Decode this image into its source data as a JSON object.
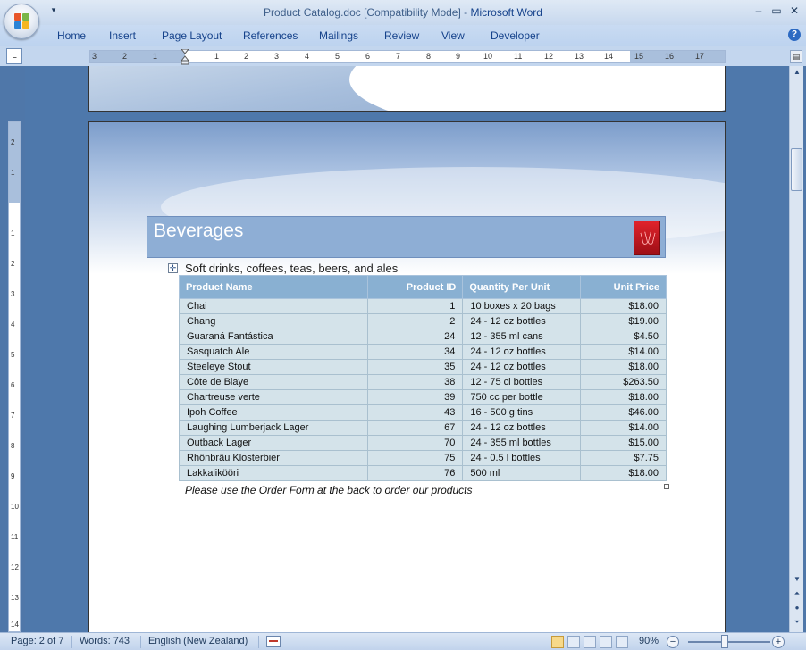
{
  "window": {
    "title_doc": "Product Catalog.doc [Compatibility Mode]",
    "title_sep": " - ",
    "title_app": "Microsoft Word"
  },
  "ribbon_tabs": [
    "Home",
    "Insert",
    "Page Layout",
    "References",
    "Mailings",
    "Review",
    "View",
    "Developer"
  ],
  "ruler": {
    "h_labels": [
      "3",
      "2",
      "1",
      "1",
      "2",
      "3",
      "4",
      "5",
      "6",
      "7",
      "8",
      "9",
      "10",
      "11",
      "12",
      "13",
      "14",
      "15",
      "16",
      "17"
    ],
    "v_labels": [
      "2",
      "1",
      "1",
      "2",
      "3",
      "4",
      "5",
      "6",
      "7",
      "8",
      "9",
      "10",
      "11",
      "12",
      "13",
      "14"
    ]
  },
  "document": {
    "section_title": "Beverages",
    "subtitle": "Soft drinks, coffees, teas, beers, and ales",
    "table": {
      "headers": [
        "Product Name",
        "Product ID",
        "Quantity Per Unit",
        "Unit Price"
      ],
      "rows": [
        [
          "Chai",
          "1",
          "10 boxes x 20 bags",
          "$18.00"
        ],
        [
          "Chang",
          "2",
          "24 - 12 oz bottles",
          "$19.00"
        ],
        [
          "Guaraná Fantástica",
          "24",
          "12 - 355 ml cans",
          "$4.50"
        ],
        [
          "Sasquatch Ale",
          "34",
          "24 - 12 oz bottles",
          "$14.00"
        ],
        [
          "Steeleye Stout",
          "35",
          "24 - 12 oz bottles",
          "$18.00"
        ],
        [
          "Côte de Blaye",
          "38",
          "12 - 75 cl bottles",
          "$263.50"
        ],
        [
          "Chartreuse verte",
          "39",
          "750 cc per bottle",
          "$18.00"
        ],
        [
          "Ipoh Coffee",
          "43",
          "16 - 500 g tins",
          "$46.00"
        ],
        [
          "Laughing Lumberjack Lager",
          "67",
          "24 - 12 oz bottles",
          "$14.00"
        ],
        [
          "Outback Lager",
          "70",
          "24 - 355 ml bottles",
          "$15.00"
        ],
        [
          "Rhönbräu Klosterbier",
          "75",
          "24 - 0.5 l bottles",
          "$7.75"
        ],
        [
          "Lakkalikööri",
          "76",
          "500 ml",
          "$18.00"
        ]
      ]
    },
    "footnote": "Please use the Order Form at the back to order our products"
  },
  "status": {
    "page": "Page: 2 of 7",
    "words": "Words: 743",
    "language": "English (New Zealand)",
    "zoom": "90%",
    "zoom_level_percent": 90
  },
  "icons": {
    "office": "office-logo-icon",
    "qat_dropdown": "qat-dropdown-icon",
    "help": "help-icon",
    "minimize": "minimize-icon",
    "maximize": "maximize-icon",
    "close": "close-icon"
  }
}
